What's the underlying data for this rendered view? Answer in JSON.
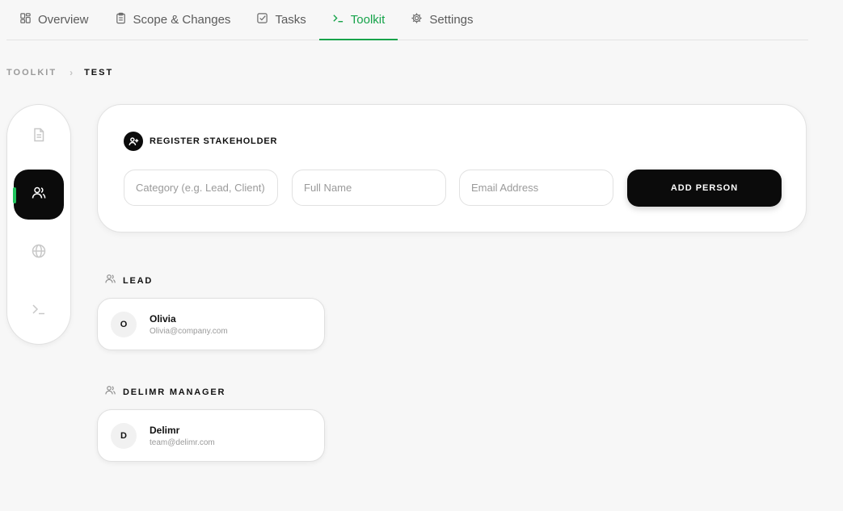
{
  "tabs": [
    {
      "label": "Overview",
      "icon": "grid-icon"
    },
    {
      "label": "Scope & Changes",
      "icon": "clipboard-icon"
    },
    {
      "label": "Tasks",
      "icon": "checkbox-icon"
    },
    {
      "label": "Toolkit",
      "icon": "terminal-icon",
      "active": true
    },
    {
      "label": "Settings",
      "icon": "gear-icon"
    }
  ],
  "breadcrumb": {
    "root": "TOOLKIT",
    "separator": "›",
    "current": "TEST"
  },
  "rail": {
    "items": [
      "document-icon",
      "users-icon",
      "globe-icon",
      "terminal-icon"
    ],
    "active": "users-icon"
  },
  "register": {
    "title": "REGISTER STAKEHOLDER",
    "category_placeholder": "Category (e.g. Lead, Client)",
    "name_placeholder": "Full Name",
    "email_placeholder": "Email Address",
    "add_label": "ADD PERSON"
  },
  "groups": [
    {
      "label": "LEAD",
      "people": [
        {
          "initial": "O",
          "name": "Olivia",
          "email": "Olivia@company.com"
        }
      ]
    },
    {
      "label": "DELIMR MANAGER",
      "people": [
        {
          "initial": "D",
          "name": "Delimr",
          "email": "team@delimr.com"
        }
      ]
    }
  ],
  "colors": {
    "accent": "#16a34a",
    "indicator": "#22c55e",
    "dark": "#0b0b0b",
    "background": "#f7f7f7"
  }
}
